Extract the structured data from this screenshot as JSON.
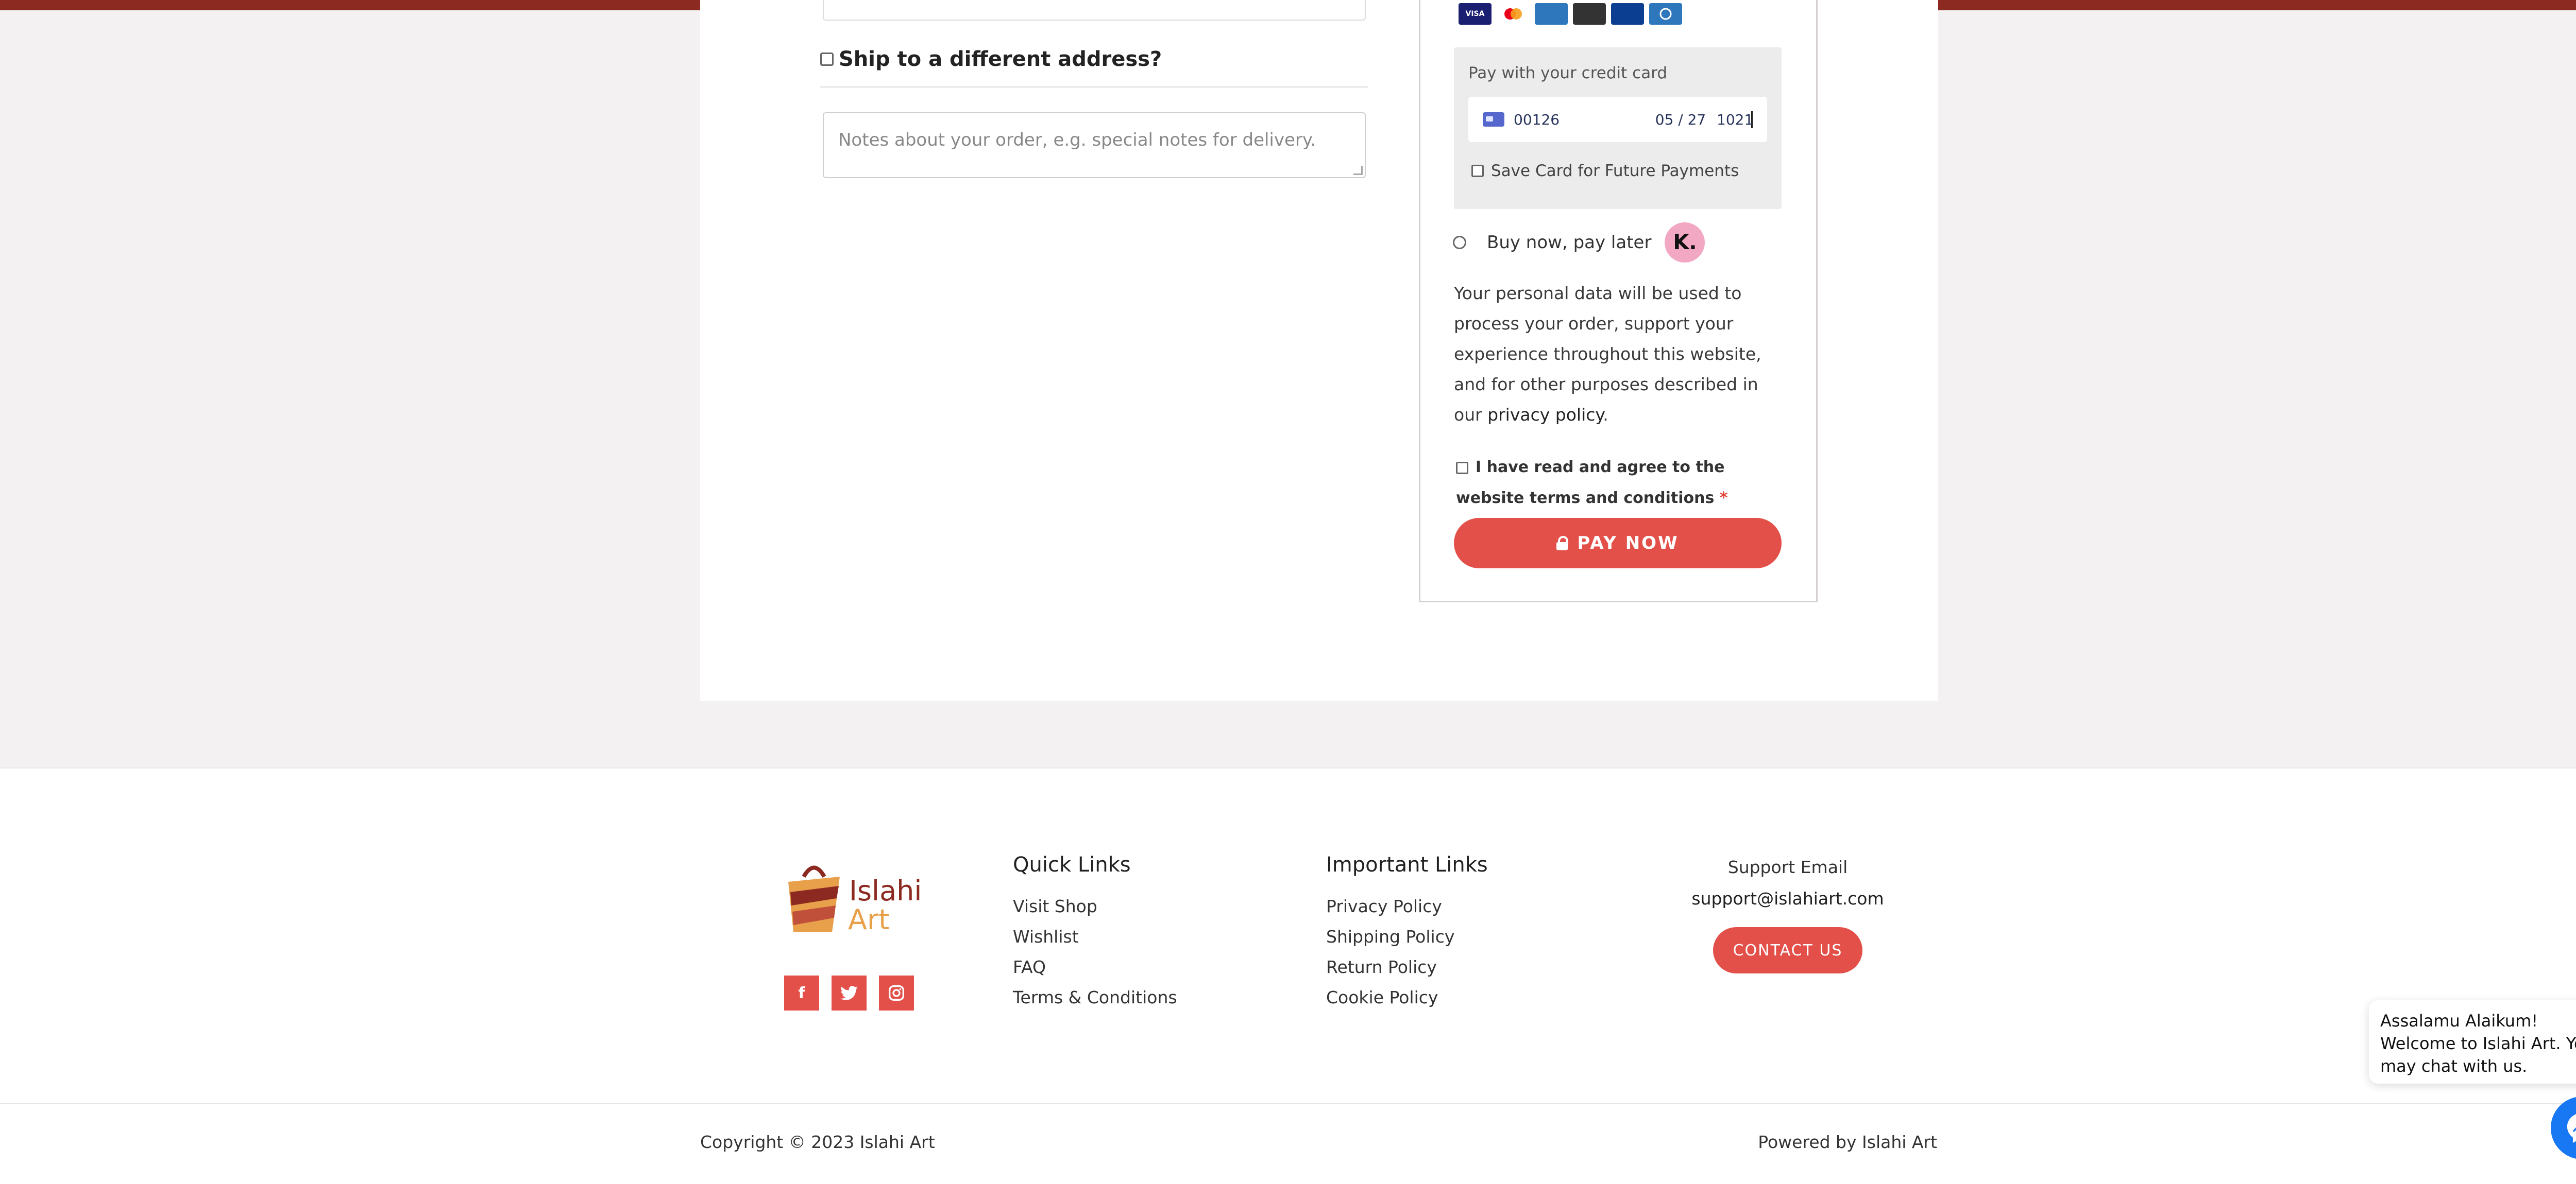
{
  "shipping": {
    "different_address_label": "Ship to a different address?",
    "notes_placeholder": "Notes about your order, e.g. special notes for delivery."
  },
  "payment": {
    "card_brands": [
      "VISA",
      "Mastercard",
      "Amex",
      "Discover",
      "JCB",
      "Diners"
    ],
    "credit_card_title": "Pay with your credit card",
    "card_number": "00126",
    "expiry": "05 / 27",
    "cvc": "1021",
    "save_card_label": "Save Card for Future Payments",
    "bnpl_label": "Buy now, pay later",
    "klarna_badge": "K.",
    "privacy_text": "Your personal data will be used to process your order, support your experience throughout this website, and for other purposes described in our ",
    "privacy_link": "privacy policy",
    "privacy_end": ".",
    "terms_text": "I have read and agree to the website terms and conditions",
    "terms_required": "*",
    "pay_button": "PAY NOW"
  },
  "footer": {
    "logo_text_top": "Islahi",
    "logo_text_bottom": "Art",
    "social": [
      "f",
      "t",
      "ig"
    ],
    "quick_links_title": "Quick Links",
    "quick_links": [
      "Visit Shop",
      "Wishlist",
      "FAQ",
      "Terms & Conditions"
    ],
    "important_links_title": "Important Links",
    "important_links": [
      "Privacy Policy",
      "Shipping Policy",
      "Return Policy",
      "Cookie Policy"
    ],
    "support_title": "Support Email",
    "support_email": "support@islahiart.com",
    "contact_button": "CONTACT US",
    "copyright": "Copyright © 2023 Islahi Art",
    "powered_by": "Powered by Islahi Art"
  },
  "chat": {
    "message": "Assalamu Alaikum! Welcome to Islahi Art. You may chat with us.",
    "close": "−"
  },
  "colors": {
    "accent": "#e3504a",
    "topbar": "#8c2a22",
    "messenger": "#1877f2",
    "klarna": "#f2a8c2"
  }
}
